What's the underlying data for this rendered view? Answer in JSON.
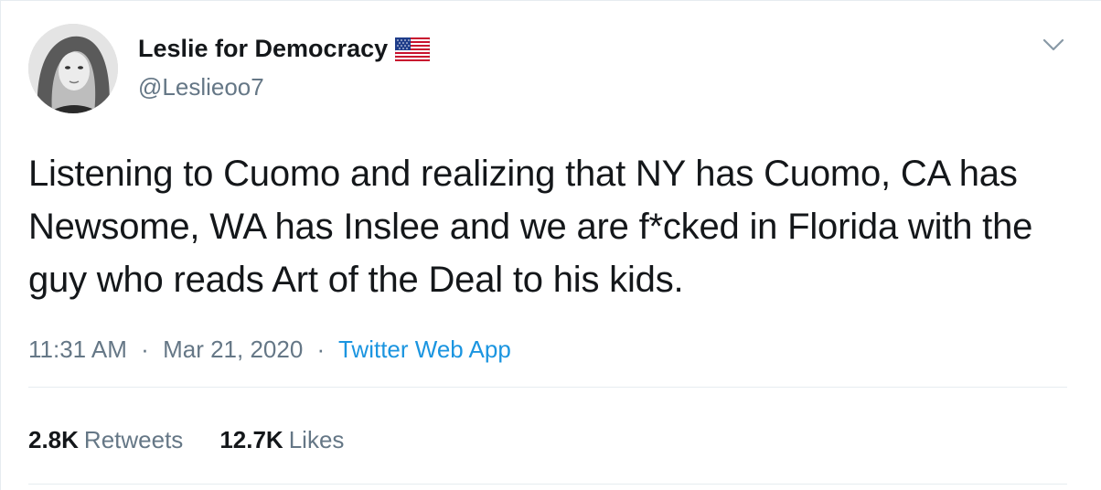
{
  "author": {
    "display_name": "Leslie for Democracy",
    "handle": "@Leslieoo7",
    "flag_icon": "us-flag-icon"
  },
  "tweet": {
    "text": "Listening to Cuomo and realizing that NY has Cuomo, CA has Newsome, WA has Inslee and we are f*cked in Florida with the guy who reads Art of the Deal to his kids.",
    "time": "11:31 AM",
    "separator": "·",
    "date": "Mar 21, 2020",
    "source": "Twitter Web App"
  },
  "stats": {
    "retweets_count": "2.8K",
    "retweets_label": "Retweets",
    "likes_count": "12.7K",
    "likes_label": "Likes"
  },
  "colors": {
    "text": "#14171a",
    "secondary": "#657786",
    "link": "#1b95e0",
    "divider": "#e6ecf0"
  }
}
